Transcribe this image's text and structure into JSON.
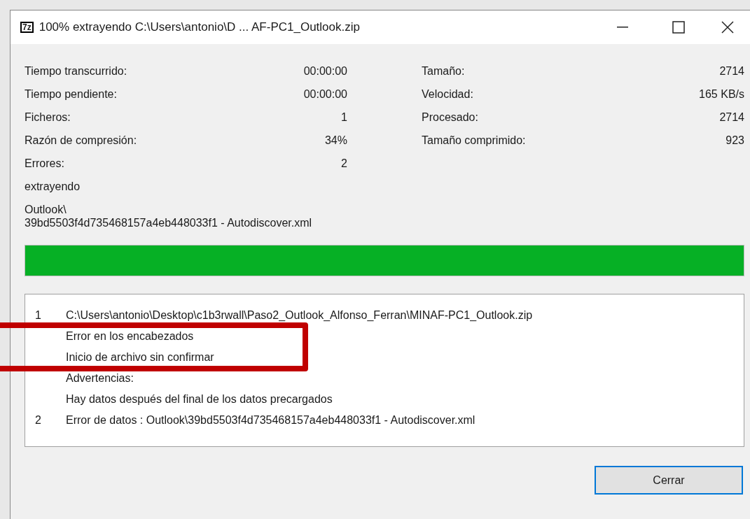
{
  "window": {
    "title": "100% extrayendo C:\\Users\\antonio\\D ... AF-PC1_Outlook.zip",
    "app_icon": "7z"
  },
  "stats_left": [
    {
      "label": "Tiempo transcurrido:",
      "value": "00:00:00"
    },
    {
      "label": "Tiempo pendiente:",
      "value": "00:00:00"
    },
    {
      "label": "Ficheros:",
      "value": "1"
    },
    {
      "label": "Razón de compresión:",
      "value": "34%"
    },
    {
      "label": "Errores:",
      "value": "2"
    }
  ],
  "stats_right": [
    {
      "label": "Tamaño:",
      "value": "2714"
    },
    {
      "label": "Velocidad:",
      "value": "165 KB/s"
    },
    {
      "label": "Procesado:",
      "value": "2714"
    },
    {
      "label": "Tamaño comprimido:",
      "value": "923"
    }
  ],
  "operation": "extrayendo",
  "current_file": [
    "Outlook\\",
    "39bd5503f4d735468157a4eb448033f1 - Autodiscover.xml"
  ],
  "progress": {
    "level": 1.0
  },
  "log": [
    {
      "number": "1",
      "text": "C:\\Users\\antonio\\Desktop\\c1b3rwall\\Paso2_Outlook_Alfonso_Ferran\\MINAF-PC1_Outlook.zip"
    },
    {
      "text": "Error en los encabezados"
    },
    {
      "text": "Inicio de archivo sin confirmar"
    },
    {
      "text": "Advertencias:"
    },
    {
      "text": "Hay datos después del final de los datos precargados"
    },
    {
      "number": "2",
      "text": "Error de datos : Outlook\\39bd5503f4d735468157a4eb448033f1 - Autodiscover.xml"
    }
  ],
  "close_button": "Cerrar"
}
